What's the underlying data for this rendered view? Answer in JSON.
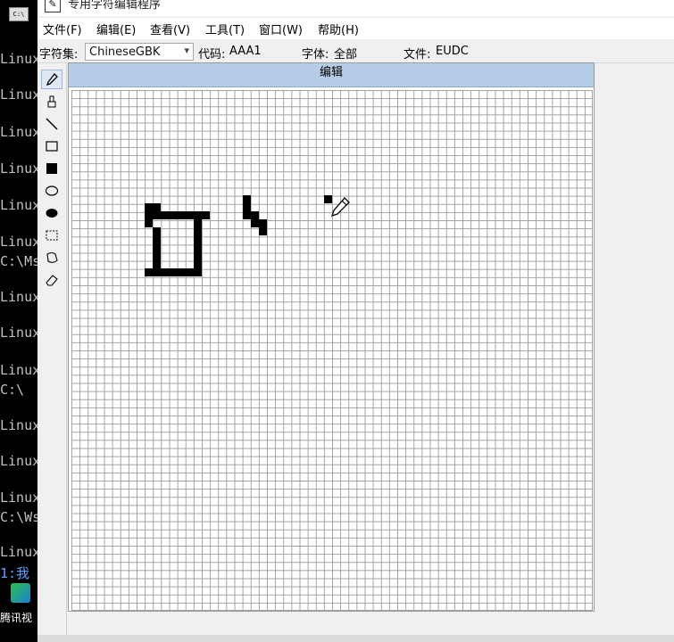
{
  "window": {
    "title": "专用字符编辑程序",
    "menus": [
      "文件(F)",
      "编辑(E)",
      "查看(V)",
      "工具(T)",
      "窗口(W)",
      "帮助(H)"
    ]
  },
  "infobar": {
    "charset_label": "字符集:",
    "charset_value": "ChineseGBK",
    "code_label": "代码:",
    "code_value": "AAA1",
    "font_label": "字体:",
    "font_value": "全部",
    "file_label": "文件:",
    "file_value": "EUDC"
  },
  "toolbox": {
    "tools": [
      "pencil-icon",
      "brush-icon",
      "line-icon",
      "rectangle-outline-icon",
      "rectangle-filled-icon",
      "ellipse-outline-icon",
      "ellipse-filled-icon",
      "rect-select-icon",
      "freeform-select-icon",
      "eraser-icon"
    ],
    "active": "pencil-icon"
  },
  "edit_panel": {
    "header": "编辑",
    "grid_size": 64
  },
  "console": {
    "lines": [
      {
        "text": "Linux",
        "highlight": false
      },
      {
        "text": "Linux",
        "highlight": false
      },
      {
        "text": "Linux",
        "highlight": false
      },
      {
        "text": "Linux",
        "highlight": false
      },
      {
        "text": "Linux",
        "highlight": false
      },
      {
        "text": "Linux",
        "highlight": false
      },
      {
        "text": "C:\\Ms",
        "highlight": false
      },
      {
        "text": "Linux",
        "highlight": false
      },
      {
        "text": "Linux",
        "highlight": false
      },
      {
        "text": "Linux",
        "highlight": false
      },
      {
        "text": "C:\\",
        "highlight": false
      },
      {
        "text": "Linux",
        "highlight": false
      },
      {
        "text": "Linux",
        "highlight": false
      },
      {
        "text": "Linux",
        "highlight": false
      },
      {
        "text": "C:\\Ws",
        "highlight": false
      },
      {
        "text": "Linux",
        "highlight": false
      },
      {
        "text": "1:我",
        "highlight": true
      }
    ],
    "taskbar_app_label": "腾讯视"
  },
  "colors": {
    "header_bg": "#b5cde6",
    "grid_line": "#a0a0a0",
    "pixel": "#000000"
  }
}
